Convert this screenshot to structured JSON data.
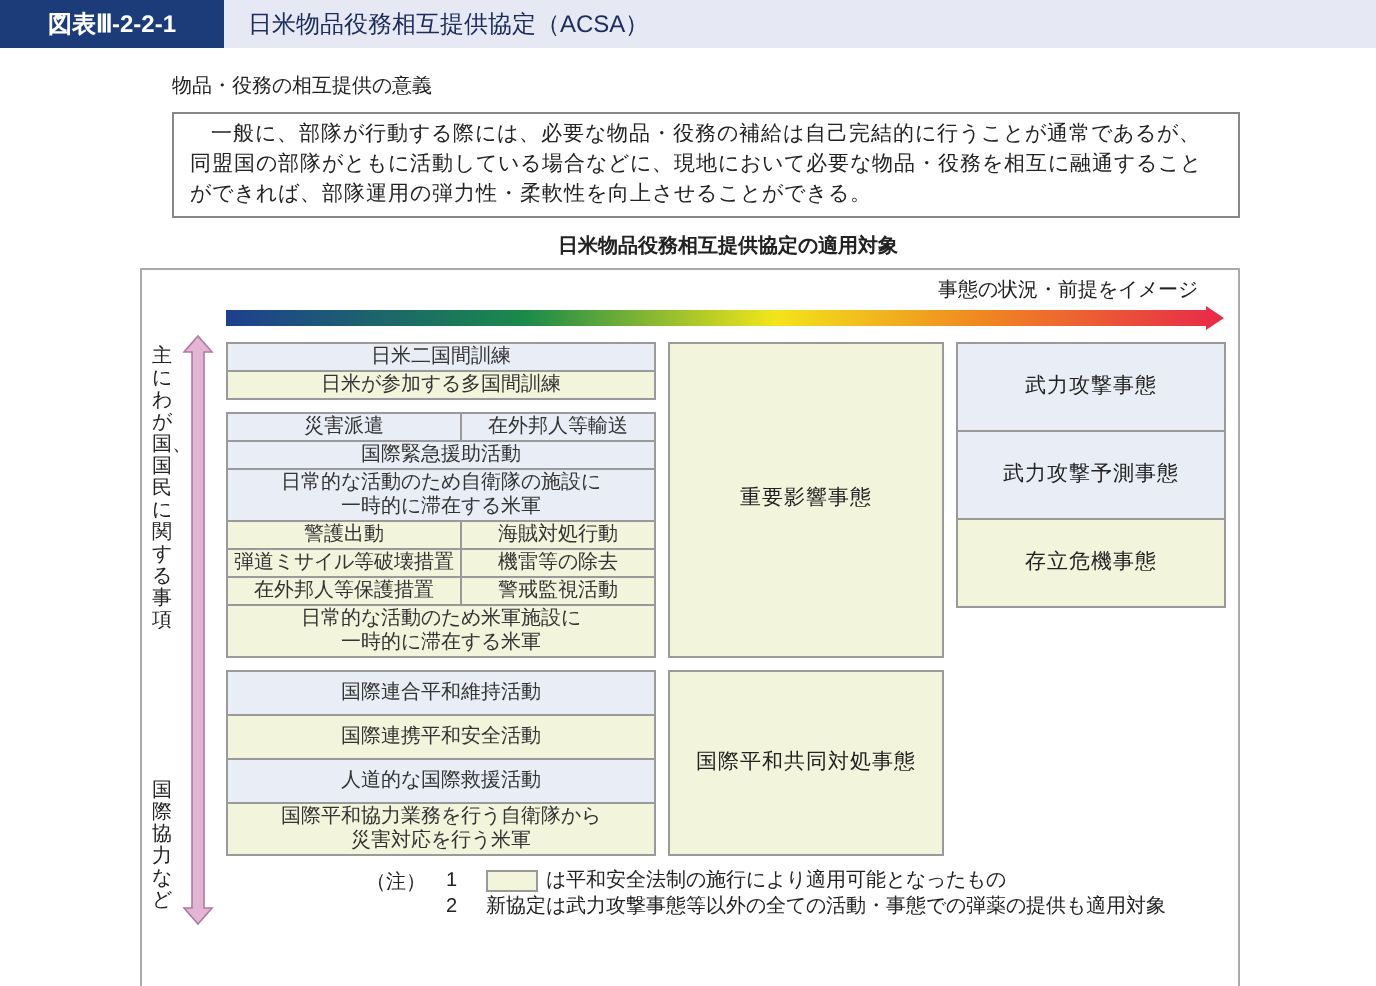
{
  "figure_label": "図表Ⅲ-2-2-1",
  "figure_title": "日米物品役務相互提供協定（ACSA）",
  "section_heading": "物品・役務の相互提供の意義",
  "description": "一般に、部隊が行動する際には、必要な物品・役務の補給は自己完結的に行うことが通常であるが、同盟国の部隊がともに活動している場合などに、現地において必要な物品・役務を相互に融通することができれば、部隊運用の弾力性・柔軟性を向上させることができる。",
  "diagram": {
    "title": "日米物品役務相互提供協定の適用対象",
    "scale_label": "事態の状況・前提をイメージ",
    "axis_labels": [
      "主にわが国、国民に関する事項",
      "国際協力など"
    ],
    "sections": [
      {
        "groups": [
          {
            "rows": [
              {
                "cells": [
                  {
                    "text": "日米二国間訓練",
                    "new": false
                  }
                ]
              },
              {
                "cells": [
                  {
                    "text": "日米が参加する多国間訓練",
                    "new": true
                  }
                ]
              }
            ]
          },
          {
            "rows": [
              {
                "cells": [
                  {
                    "text": "災害派遣",
                    "new": false
                  },
                  {
                    "text": "在外邦人等輸送",
                    "new": false
                  }
                ]
              },
              {
                "cells": [
                  {
                    "text": "国際緊急援助活動",
                    "new": false
                  }
                ]
              },
              {
                "cells": [
                  {
                    "lines": [
                      "日常的な活動のため自衛隊の施設に",
                      "一時的に滞在する米軍"
                    ],
                    "new": false
                  }
                ]
              },
              {
                "cells": [
                  {
                    "text": "警護出動",
                    "new": true
                  },
                  {
                    "text": "海賊対処行動",
                    "new": true
                  }
                ]
              },
              {
                "cells": [
                  {
                    "text": "弾道ミサイル等破壊措置",
                    "new": true
                  },
                  {
                    "text": "機雷等の除去",
                    "new": true
                  }
                ]
              },
              {
                "cells": [
                  {
                    "text": "在外邦人等保護措置",
                    "new": true
                  },
                  {
                    "text": "警戒監視活動",
                    "new": true
                  }
                ]
              },
              {
                "cells": [
                  {
                    "lines": [
                      "日常的な活動のため米軍施設に",
                      "一時的に滞在する米軍"
                    ],
                    "new": true
                  }
                ]
              }
            ]
          }
        ],
        "middle": {
          "text": "重要影響事態",
          "new": true
        },
        "right": [
          {
            "text": "武力攻撃事態",
            "new": false
          },
          {
            "text": "武力攻撃予測事態",
            "new": false
          },
          {
            "text": "存立危機事態",
            "new": true
          }
        ]
      },
      {
        "groups": [
          {
            "rows": [
              {
                "cells": [
                  {
                    "text": "国際連合平和維持活動",
                    "new": false
                  }
                ]
              },
              {
                "cells": [
                  {
                    "text": "国際連携平和安全活動",
                    "new": true
                  }
                ]
              },
              {
                "cells": [
                  {
                    "text": "人道的な国際救援活動",
                    "new": false
                  }
                ]
              },
              {
                "cells": [
                  {
                    "lines": [
                      "国際平和協力業務を行う自衛隊から",
                      "災害対応を行う米軍"
                    ],
                    "new": true
                  }
                ]
              }
            ]
          }
        ],
        "middle": {
          "text": "国際平和共同対処事態",
          "new": true
        }
      }
    ]
  },
  "notes_label": "（注）",
  "notes": [
    {
      "number": "1",
      "kind": "swatch",
      "text": "は平和安全法制の施行により適用可能となったもの"
    },
    {
      "number": "2",
      "kind": "plain",
      "text": "新協定は武力攻撃事態等以外の全ての活動・事態での弾薬の提供も適用対象"
    }
  ]
}
